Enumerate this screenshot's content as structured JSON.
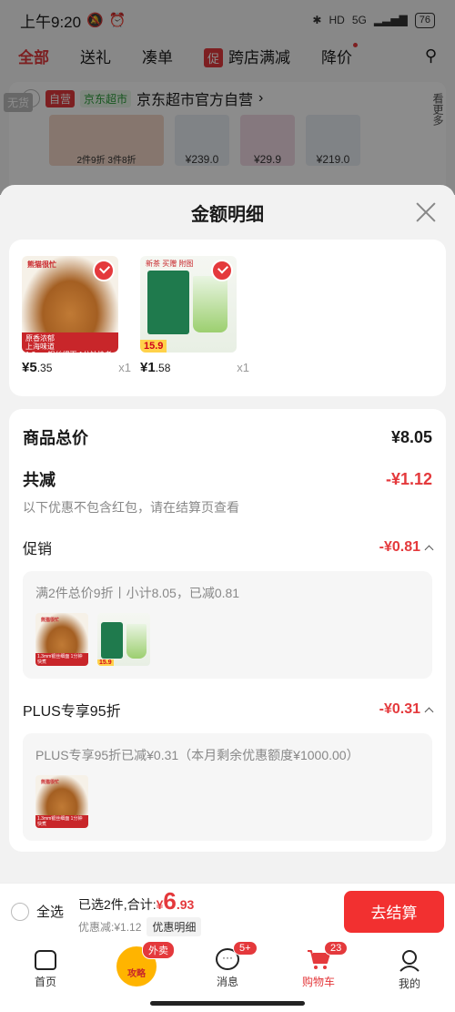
{
  "status_bar": {
    "time": "上午9:20",
    "network": "5G",
    "hd": "HD",
    "battery": "76"
  },
  "background_cart": {
    "tabs": [
      {
        "label": "全部",
        "active": true
      },
      {
        "label": "送礼"
      },
      {
        "label": "凑单"
      },
      {
        "label": "跨店满减",
        "badge": "促"
      },
      {
        "label": "降价"
      }
    ],
    "store": {
      "tag_self": "自营",
      "tag_super": "京东超市",
      "name": "京东超市官方自营",
      "out_of_stock": "无货",
      "see_more": "看更多",
      "big_item_text": "2件9折 3件8折",
      "item_prices": [
        "¥239.0",
        "¥29.9",
        "¥219.0"
      ],
      "item_tags": [
        "139",
        "119"
      ]
    }
  },
  "sheet": {
    "title": "金额明细",
    "goods": [
      {
        "price_int": "¥5",
        "price_dec": ".35",
        "qty": "x1",
        "brand": "熊猫很忙",
        "strip_line1": "原香浓郁",
        "strip_line2": "上海味道",
        "strip_line3": "1.3mm银丝细面 1分钟快煮"
      },
      {
        "price_int": "¥1",
        "price_dec": ".58",
        "qty": "x1",
        "tags": "新茶 买赠 附图",
        "price_tag": "15.9",
        "caption": "清香耐泡 原叶制 + 买赠自饮"
      }
    ],
    "total_label": "商品总价",
    "total_value": "¥8.05",
    "discount_label": "共减",
    "discount_value": "-¥1.12",
    "discount_note": "以下优惠不包含红包，请在结算页查看",
    "promo": {
      "label": "促销",
      "value": "-¥0.81",
      "detail": "满2件总价9折丨小计8.05，已减0.81"
    },
    "plus": {
      "label": "PLUS专享95折",
      "value": "-¥0.31",
      "detail": "PLUS专享95折已减¥0.31（本月剩余优惠额度¥1000.00）"
    }
  },
  "checkout": {
    "select_all": "全选",
    "selected_text": "已选2件,合计:",
    "total_yen": "¥",
    "total_int": "6",
    "total_dec": ".93",
    "discount_text": "优惠减:¥1.12",
    "detail_link": "优惠明细",
    "button": "去结算"
  },
  "bottom_nav": [
    {
      "label": "首页",
      "icon": "home-icon"
    },
    {
      "label": "攻略",
      "icon": "waimai-icon",
      "badge": "外卖"
    },
    {
      "label": "消息",
      "icon": "message-icon",
      "badge": "5+"
    },
    {
      "label": "购物车",
      "icon": "cart-icon",
      "badge": "23",
      "active": true
    },
    {
      "label": "我的",
      "icon": "profile-icon"
    }
  ],
  "colors": {
    "accent": "#e4393c",
    "checkout": "#f23030"
  }
}
